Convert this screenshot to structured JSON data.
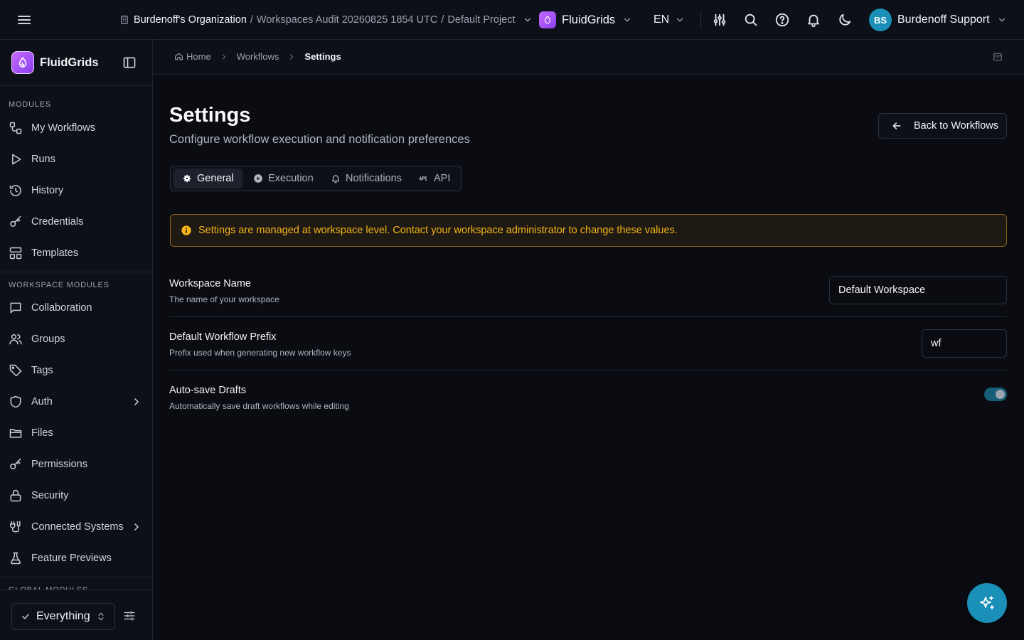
{
  "topbar": {
    "org": "Burdenoff's Organization",
    "separator": "/",
    "workspace": "Workspaces Audit 20260825 1854 UTC",
    "project": "Default Project",
    "app_name": "FluidGrids",
    "language": "EN",
    "user": {
      "initials": "BS",
      "name": "Burdenoff Support"
    }
  },
  "sidebar": {
    "brand": "FluidGrids",
    "modules_label": "MODULES",
    "modules": [
      {
        "label": "My Workflows",
        "icon": "workflow-icon"
      },
      {
        "label": "Runs",
        "icon": "play-icon"
      },
      {
        "label": "History",
        "icon": "history-icon"
      },
      {
        "label": "Credentials",
        "icon": "key-icon"
      },
      {
        "label": "Templates",
        "icon": "templates-icon"
      }
    ],
    "workspace_modules_label": "WORKSPACE MODULES",
    "workspace_modules": [
      {
        "label": "Collaboration",
        "icon": "chat-icon"
      },
      {
        "label": "Groups",
        "icon": "users-icon"
      },
      {
        "label": "Tags",
        "icon": "tag-icon"
      },
      {
        "label": "Auth",
        "icon": "shield-icon"
      },
      {
        "label": "Files",
        "icon": "folder-icon"
      },
      {
        "label": "Permissions",
        "icon": "key-icon"
      },
      {
        "label": "Security",
        "icon": "lock-icon"
      },
      {
        "label": "Connected Systems",
        "icon": "plug-icon"
      },
      {
        "label": "Feature Previews",
        "icon": "flask-icon"
      }
    ],
    "global_modules_label": "GLOBAL MODULES",
    "filter_value": "Everything"
  },
  "breadcrumb": {
    "items": [
      "Home",
      "Workflows",
      "Settings"
    ]
  },
  "page": {
    "title": "Settings",
    "subtitle": "Configure workflow execution and notification preferences",
    "back_button": "Back to Workflows"
  },
  "tabs": [
    {
      "label": "General",
      "icon": "gear-icon",
      "active": true
    },
    {
      "label": "Execution",
      "icon": "play-circle-icon",
      "active": false
    },
    {
      "label": "Notifications",
      "icon": "bell-icon",
      "active": false
    },
    {
      "label": "API",
      "icon": "api-icon",
      "active": false
    }
  ],
  "alert": {
    "message": "Settings are managed at workspace level. Contact your workspace administrator to change these values.",
    "color": "#f5b51b"
  },
  "settings": {
    "workspace_name": {
      "label": "Workspace Name",
      "description": "The name of your workspace",
      "value": "Default Workspace"
    },
    "workflow_prefix": {
      "label": "Default Workflow Prefix",
      "description": "Prefix used when generating new workflow keys",
      "value": "wf"
    },
    "autosave": {
      "label": "Auto-save Drafts",
      "description": "Automatically save draft workflows while editing",
      "enabled": true
    }
  },
  "colors": {
    "accent": "#1a8fb8",
    "brand": "#a855f7",
    "background": "#0a0c12"
  }
}
